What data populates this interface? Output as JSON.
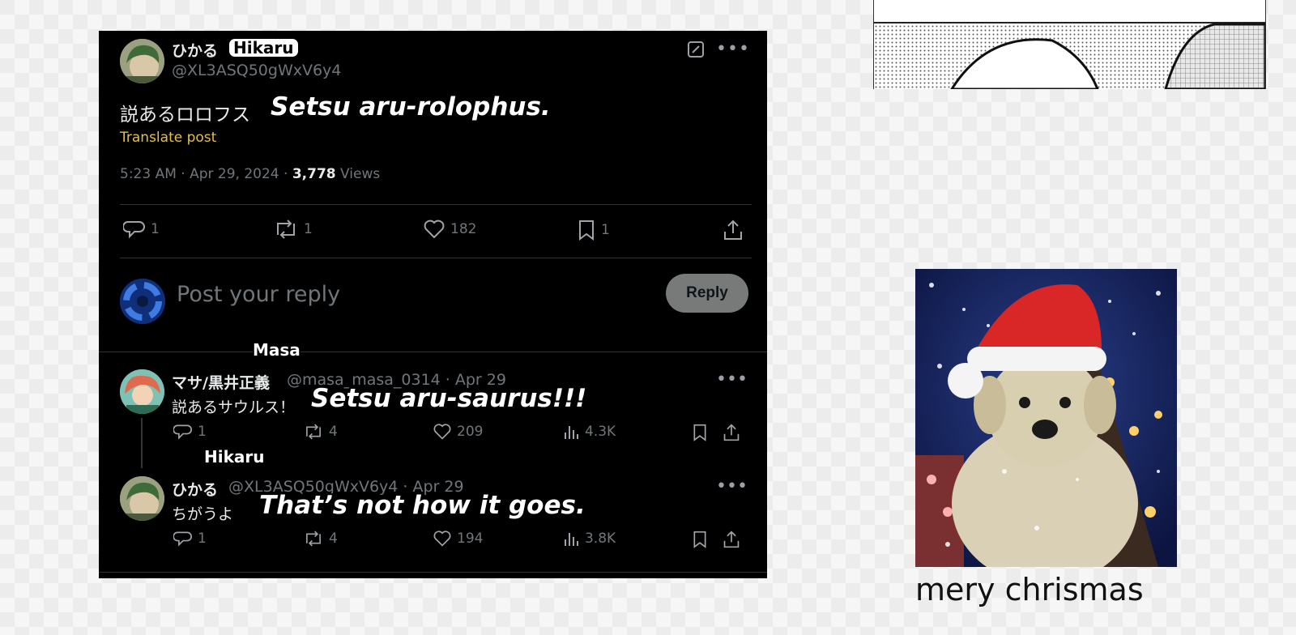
{
  "main_tweet": {
    "display_name": "ひかる",
    "name_label": "Hikaru",
    "handle": "@XL3ASQ50gWxV6y4",
    "text": "説あるロロフス",
    "translation": "Setsu aru-rolophus.",
    "translate_link": "Translate post",
    "timestamp": "5:23 AM · Apr 29, 2024 · ",
    "views_count": "3,778",
    "views_label": " Views",
    "stats": {
      "replies": "1",
      "reposts": "1",
      "likes": "182",
      "bookmarks": "1"
    }
  },
  "reply_box": {
    "placeholder": "Post your reply",
    "button_label": "Reply"
  },
  "replies": [
    {
      "display_name": "マサ/黒井正義",
      "name_label": "Masa",
      "handle_date": "@masa_masa_0314 · Apr 29",
      "text": "説あるサウルス！",
      "translation": "Setsu aru-saurus!!!",
      "stats": {
        "replies": "1",
        "reposts": "4",
        "likes": "209",
        "views": "4.3K"
      }
    },
    {
      "display_name": "ひかる",
      "name_label": "Hikaru",
      "handle_date": "@XL3ASQ50gWxV6y4 · Apr 29",
      "text": "ちがうよ",
      "translation": "That’s not how it goes.",
      "stats": {
        "replies": "1",
        "reposts": "4",
        "likes": "194",
        "views": "3.8K"
      }
    }
  ],
  "caption": "mery chrismas",
  "colors": {
    "background": "#000000",
    "translate_link": "#e4c04a",
    "muted": "#71767b",
    "reply_button": "#787a7a"
  },
  "icons": [
    "edit-icon",
    "more-icon",
    "reply-icon",
    "repost-icon",
    "like-icon",
    "bookmark-icon",
    "share-icon",
    "views-icon"
  ]
}
